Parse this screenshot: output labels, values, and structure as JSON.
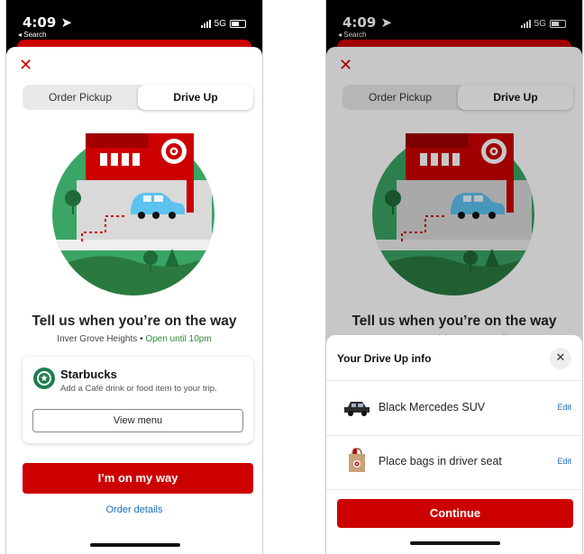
{
  "status": {
    "time": "4:09",
    "back_label": "◂ Search",
    "network": "5G"
  },
  "segmented": {
    "option1": "Order Pickup",
    "option2": "Drive Up"
  },
  "main": {
    "headline": "Tell us when you’re on the way",
    "store": "Inver Grove Heights",
    "separator": "•",
    "open_status": "Open until 10pm"
  },
  "starbucks_card": {
    "title": "Starbucks",
    "subtitle": "Add a Café drink or food item to your trip.",
    "button": "View menu"
  },
  "actions": {
    "primary": "I’m on my way",
    "secondary": "Order details"
  },
  "drive_up_sheet": {
    "title": "Your Drive Up info",
    "rows": [
      {
        "label": "Black Mercedes SUV",
        "edit": "Edit",
        "icon": "car-icon"
      },
      {
        "label": "Place bags in driver seat",
        "edit": "Edit",
        "icon": "shopping-bag-icon"
      }
    ],
    "continue": "Continue"
  },
  "colors": {
    "brand_red": "#cc0000",
    "link_blue": "#1a6bc2",
    "open_green": "#2e8b3a",
    "park_green": "#2f9a57",
    "car_blue": "#5cc2f0"
  }
}
